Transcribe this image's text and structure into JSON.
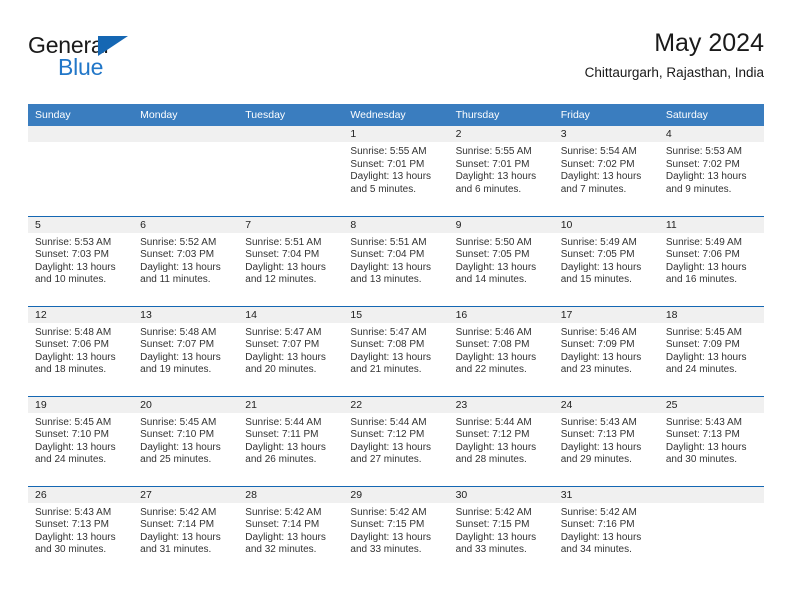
{
  "brand": {
    "name_part1": "General",
    "name_part2": "Blue",
    "triangle_color": "#1567b3",
    "blue_text_color": "#2277c8"
  },
  "header": {
    "title": "May 2024",
    "subtitle": "Chittaurgarh, Rajasthan, India"
  },
  "theme": {
    "header_row_bg": "#3a7dbf",
    "row_divider": "#1567b3",
    "daynum_band_bg": "#f0f0f0",
    "text_color": "#333333"
  },
  "weekday_headers": [
    "Sunday",
    "Monday",
    "Tuesday",
    "Wednesday",
    "Thursday",
    "Friday",
    "Saturday"
  ],
  "weeks": [
    [
      {
        "day": "",
        "empty": true
      },
      {
        "day": "",
        "empty": true
      },
      {
        "day": "",
        "empty": true
      },
      {
        "day": "1",
        "sunrise": "Sunrise: 5:55 AM",
        "sunset": "Sunset: 7:01 PM",
        "daylight": "Daylight: 13 hours and 5 minutes."
      },
      {
        "day": "2",
        "sunrise": "Sunrise: 5:55 AM",
        "sunset": "Sunset: 7:01 PM",
        "daylight": "Daylight: 13 hours and 6 minutes."
      },
      {
        "day": "3",
        "sunrise": "Sunrise: 5:54 AM",
        "sunset": "Sunset: 7:02 PM",
        "daylight": "Daylight: 13 hours and 7 minutes."
      },
      {
        "day": "4",
        "sunrise": "Sunrise: 5:53 AM",
        "sunset": "Sunset: 7:02 PM",
        "daylight": "Daylight: 13 hours and 9 minutes."
      }
    ],
    [
      {
        "day": "5",
        "sunrise": "Sunrise: 5:53 AM",
        "sunset": "Sunset: 7:03 PM",
        "daylight": "Daylight: 13 hours and 10 minutes."
      },
      {
        "day": "6",
        "sunrise": "Sunrise: 5:52 AM",
        "sunset": "Sunset: 7:03 PM",
        "daylight": "Daylight: 13 hours and 11 minutes."
      },
      {
        "day": "7",
        "sunrise": "Sunrise: 5:51 AM",
        "sunset": "Sunset: 7:04 PM",
        "daylight": "Daylight: 13 hours and 12 minutes."
      },
      {
        "day": "8",
        "sunrise": "Sunrise: 5:51 AM",
        "sunset": "Sunset: 7:04 PM",
        "daylight": "Daylight: 13 hours and 13 minutes."
      },
      {
        "day": "9",
        "sunrise": "Sunrise: 5:50 AM",
        "sunset": "Sunset: 7:05 PM",
        "daylight": "Daylight: 13 hours and 14 minutes."
      },
      {
        "day": "10",
        "sunrise": "Sunrise: 5:49 AM",
        "sunset": "Sunset: 7:05 PM",
        "daylight": "Daylight: 13 hours and 15 minutes."
      },
      {
        "day": "11",
        "sunrise": "Sunrise: 5:49 AM",
        "sunset": "Sunset: 7:06 PM",
        "daylight": "Daylight: 13 hours and 16 minutes."
      }
    ],
    [
      {
        "day": "12",
        "sunrise": "Sunrise: 5:48 AM",
        "sunset": "Sunset: 7:06 PM",
        "daylight": "Daylight: 13 hours and 18 minutes."
      },
      {
        "day": "13",
        "sunrise": "Sunrise: 5:48 AM",
        "sunset": "Sunset: 7:07 PM",
        "daylight": "Daylight: 13 hours and 19 minutes."
      },
      {
        "day": "14",
        "sunrise": "Sunrise: 5:47 AM",
        "sunset": "Sunset: 7:07 PM",
        "daylight": "Daylight: 13 hours and 20 minutes."
      },
      {
        "day": "15",
        "sunrise": "Sunrise: 5:47 AM",
        "sunset": "Sunset: 7:08 PM",
        "daylight": "Daylight: 13 hours and 21 minutes."
      },
      {
        "day": "16",
        "sunrise": "Sunrise: 5:46 AM",
        "sunset": "Sunset: 7:08 PM",
        "daylight": "Daylight: 13 hours and 22 minutes."
      },
      {
        "day": "17",
        "sunrise": "Sunrise: 5:46 AM",
        "sunset": "Sunset: 7:09 PM",
        "daylight": "Daylight: 13 hours and 23 minutes."
      },
      {
        "day": "18",
        "sunrise": "Sunrise: 5:45 AM",
        "sunset": "Sunset: 7:09 PM",
        "daylight": "Daylight: 13 hours and 24 minutes."
      }
    ],
    [
      {
        "day": "19",
        "sunrise": "Sunrise: 5:45 AM",
        "sunset": "Sunset: 7:10 PM",
        "daylight": "Daylight: 13 hours and 24 minutes."
      },
      {
        "day": "20",
        "sunrise": "Sunrise: 5:45 AM",
        "sunset": "Sunset: 7:10 PM",
        "daylight": "Daylight: 13 hours and 25 minutes."
      },
      {
        "day": "21",
        "sunrise": "Sunrise: 5:44 AM",
        "sunset": "Sunset: 7:11 PM",
        "daylight": "Daylight: 13 hours and 26 minutes."
      },
      {
        "day": "22",
        "sunrise": "Sunrise: 5:44 AM",
        "sunset": "Sunset: 7:12 PM",
        "daylight": "Daylight: 13 hours and 27 minutes."
      },
      {
        "day": "23",
        "sunrise": "Sunrise: 5:44 AM",
        "sunset": "Sunset: 7:12 PM",
        "daylight": "Daylight: 13 hours and 28 minutes."
      },
      {
        "day": "24",
        "sunrise": "Sunrise: 5:43 AM",
        "sunset": "Sunset: 7:13 PM",
        "daylight": "Daylight: 13 hours and 29 minutes."
      },
      {
        "day": "25",
        "sunrise": "Sunrise: 5:43 AM",
        "sunset": "Sunset: 7:13 PM",
        "daylight": "Daylight: 13 hours and 30 minutes."
      }
    ],
    [
      {
        "day": "26",
        "sunrise": "Sunrise: 5:43 AM",
        "sunset": "Sunset: 7:13 PM",
        "daylight": "Daylight: 13 hours and 30 minutes."
      },
      {
        "day": "27",
        "sunrise": "Sunrise: 5:42 AM",
        "sunset": "Sunset: 7:14 PM",
        "daylight": "Daylight: 13 hours and 31 minutes."
      },
      {
        "day": "28",
        "sunrise": "Sunrise: 5:42 AM",
        "sunset": "Sunset: 7:14 PM",
        "daylight": "Daylight: 13 hours and 32 minutes."
      },
      {
        "day": "29",
        "sunrise": "Sunrise: 5:42 AM",
        "sunset": "Sunset: 7:15 PM",
        "daylight": "Daylight: 13 hours and 33 minutes."
      },
      {
        "day": "30",
        "sunrise": "Sunrise: 5:42 AM",
        "sunset": "Sunset: 7:15 PM",
        "daylight": "Daylight: 13 hours and 33 minutes."
      },
      {
        "day": "31",
        "sunrise": "Sunrise: 5:42 AM",
        "sunset": "Sunset: 7:16 PM",
        "daylight": "Daylight: 13 hours and 34 minutes."
      },
      {
        "day": "",
        "empty": true
      }
    ]
  ]
}
